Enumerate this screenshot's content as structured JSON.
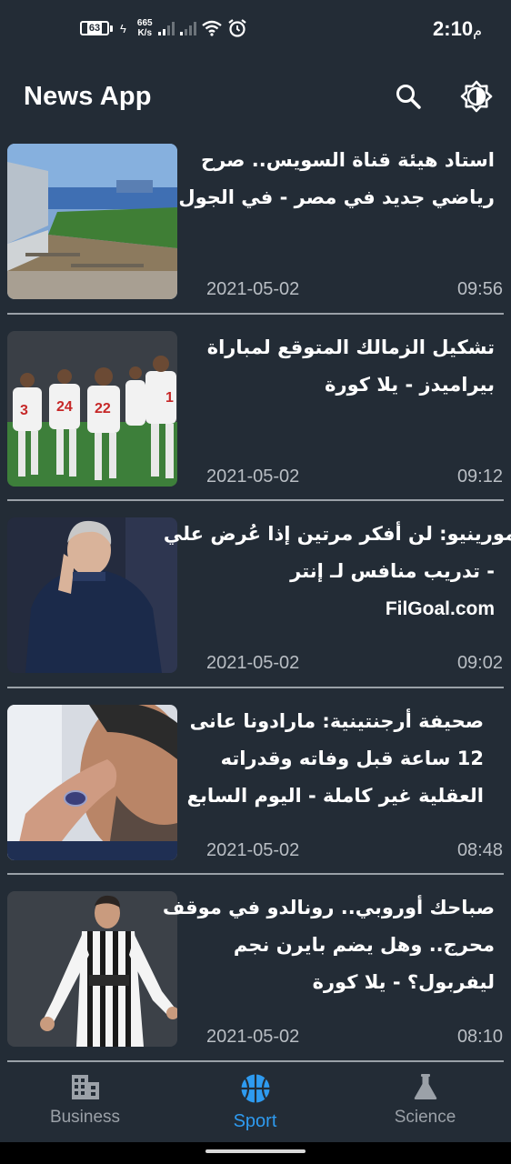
{
  "status_bar": {
    "time": "2:10",
    "ampm": "م",
    "battery": "63",
    "speed_value": "665",
    "speed_unit": "K/s"
  },
  "header": {
    "title": "News App",
    "search_icon": "search-icon",
    "theme_icon": "brightness-icon"
  },
  "articles": [
    {
      "headline_lines": [
        "استاد هيئة قناة السويس.. صرح",
        "رياضي جديد في مصر - في الجول"
      ],
      "date": "2021-05-02",
      "time": "09:56",
      "image": "stadium-photo"
    },
    {
      "headline_lines": [
        "تشكيل الزمالك المتوقع لمباراة",
        "بيراميدز - يلا كورة"
      ],
      "date": "2021-05-02",
      "time": "09:12",
      "image": "zamalek-players-photo"
    },
    {
      "headline_lines": [
        "مورينيو: لن أفكر مرتين إذا عُرض علي",
        "- تدريب منافس لـ إنتر",
        "FilGoal.com"
      ],
      "date": "2021-05-02",
      "time": "09:02",
      "image": "mourinho-photo"
    },
    {
      "headline_lines": [
        "صحيفة أرجنتينية: مارادونا عانى",
        "12 ساعة قبل وفاته وقدراته",
        "العقلية غير كاملة - اليوم السابع"
      ],
      "date": "2021-05-02",
      "time": "08:48",
      "image": "maradona-photo"
    },
    {
      "headline_lines": [
        "صباحك أوروبي.. رونالدو في موقف",
        "محرج.. وهل يضم بايرن نجم",
        "ليفربول؟ - يلا كورة"
      ],
      "date": "2021-05-02",
      "time": "08:10",
      "image": "ronaldo-photo"
    }
  ],
  "bottom_nav": {
    "items": [
      {
        "label": "Business",
        "icon": "business-building-icon"
      },
      {
        "label": "Sport",
        "icon": "sport-ball-icon"
      },
      {
        "label": "Science",
        "icon": "science-flask-icon"
      }
    ],
    "active": "Sport"
  },
  "colors": {
    "background": "#232c36",
    "active_accent": "#2e9bf0",
    "inactive_nav": "#9ba1a8",
    "meta_text": "#b9bec4",
    "divider": "#9aa1a8"
  }
}
